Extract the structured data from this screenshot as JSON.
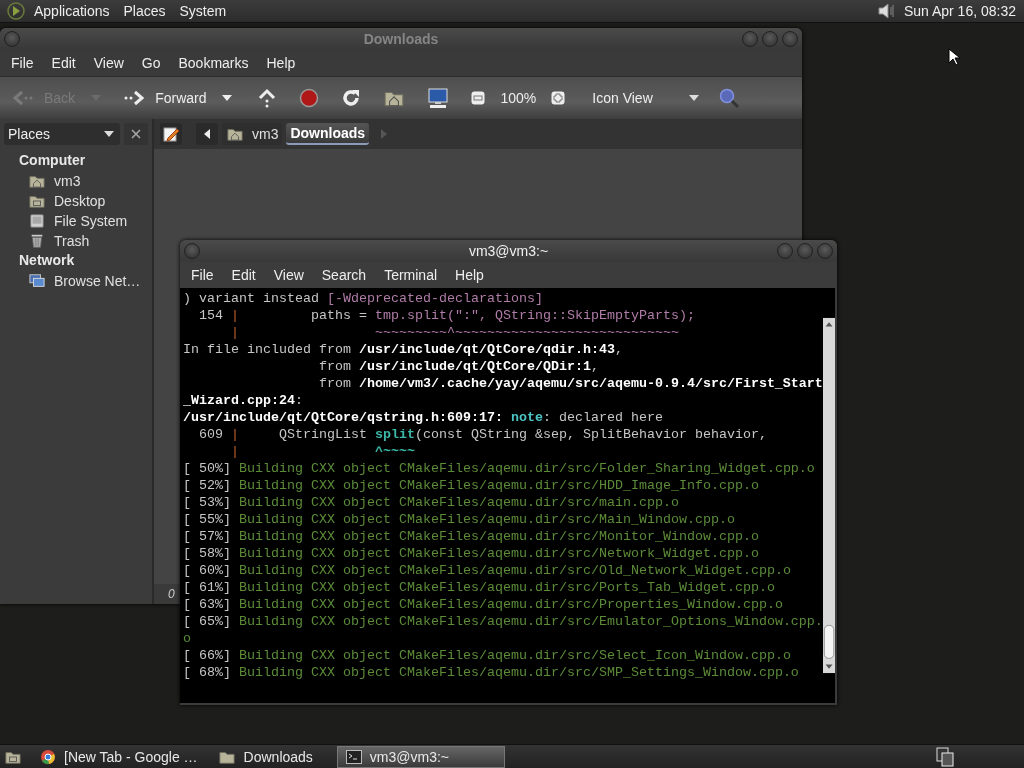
{
  "top_panel": {
    "menus": [
      "Applications",
      "Places",
      "System"
    ],
    "clock": "Sun Apr 16, 08:32"
  },
  "file_manager": {
    "title": "Downloads",
    "active": false,
    "menu": [
      "File",
      "Edit",
      "View",
      "Go",
      "Bookmarks",
      "Help"
    ],
    "toolbar": {
      "back": {
        "label": "Back",
        "disabled": true
      },
      "forward": {
        "label": "Forward",
        "disabled": false
      },
      "zoom": "100%",
      "view": "Icon View"
    },
    "sidebar": {
      "title": "Places",
      "sections": [
        {
          "heading": "Computer",
          "items": [
            {
              "label": "vm3",
              "kind": "home"
            },
            {
              "label": "Desktop",
              "kind": "desktop"
            },
            {
              "label": "File System",
              "kind": "drive"
            },
            {
              "label": "Trash",
              "kind": "trash"
            }
          ]
        },
        {
          "heading": "Network",
          "items": [
            {
              "label": "Browse Net…",
              "kind": "network"
            }
          ]
        }
      ]
    },
    "path": [
      {
        "label": "vm3",
        "kind": "home",
        "selected": false
      },
      {
        "label": "Downloads",
        "kind": "plain",
        "selected": true
      }
    ],
    "status": "0"
  },
  "terminal": {
    "title": "vm3@vm3:~",
    "active": true,
    "menu": [
      "File",
      "Edit",
      "View",
      "Search",
      "Terminal",
      "Help"
    ],
    "lines": [
      [
        {
          "kind": "text",
          "text": ") variant instead "
        },
        {
          "kind": "warn",
          "text": "[-Wdeprecated-declarations]"
        }
      ],
      [
        {
          "kind": "text",
          "text": "  154 "
        },
        {
          "kind": "gutter",
          "text": "|"
        },
        {
          "kind": "text",
          "text": "         paths = "
        },
        {
          "kind": "warn",
          "text": "tmp.split(\":\", QString::SkipEmptyParts);"
        }
      ],
      [
        {
          "kind": "gutter",
          "text": "      |"
        },
        {
          "kind": "warn",
          "text": "                 ~~~~~~~~~^~~~~~~~~~~~~~~~~~~~~~~~~~~~~"
        }
      ],
      [
        {
          "kind": "text",
          "text": "In file included from "
        },
        {
          "kind": "bold",
          "text": "/usr/include/qt/QtCore/qdir.h:43"
        },
        {
          "kind": "text",
          "text": ","
        }
      ],
      [
        {
          "kind": "text",
          "text": "                 from "
        },
        {
          "kind": "bold",
          "text": "/usr/include/qt/QtCore/QDir:1"
        },
        {
          "kind": "text",
          "text": ","
        }
      ],
      [
        {
          "kind": "text",
          "text": "                 from "
        },
        {
          "kind": "bold",
          "text": "/home/vm3/.cache/yay/aqemu/src/aqemu-0.9.4/src/First_Start"
        }
      ],
      [
        {
          "kind": "bold",
          "text": "_Wizard.cpp:24"
        },
        {
          "kind": "text",
          "text": ":"
        }
      ],
      [
        {
          "kind": "bold",
          "text": "/usr/include/qt/QtCore/qstring.h:609:17: "
        },
        {
          "kind": "note",
          "text": "note"
        },
        {
          "kind": "text",
          "text": ": declared here"
        }
      ],
      [
        {
          "kind": "text",
          "text": "  609 "
        },
        {
          "kind": "gutter",
          "text": "|"
        },
        {
          "kind": "text",
          "text": "     QStringList "
        },
        {
          "kind": "fix",
          "text": "split"
        },
        {
          "kind": "text",
          "text": "(const QString &sep, SplitBehavior behavior,"
        }
      ],
      [
        {
          "kind": "gutter",
          "text": "      |"
        },
        {
          "kind": "fix",
          "text": "                 ^~~~~"
        }
      ],
      [
        {
          "kind": "text",
          "text": "[ 50%] "
        },
        {
          "kind": "build",
          "text": "Building CXX object CMakeFiles/aqemu.dir/src/Folder_Sharing_Widget.cpp.o"
        }
      ],
      [
        {
          "kind": "text",
          "text": "[ 52%] "
        },
        {
          "kind": "build",
          "text": "Building CXX object CMakeFiles/aqemu.dir/src/HDD_Image_Info.cpp.o"
        }
      ],
      [
        {
          "kind": "text",
          "text": "[ 53%] "
        },
        {
          "kind": "build",
          "text": "Building CXX object CMakeFiles/aqemu.dir/src/main.cpp.o"
        }
      ],
      [
        {
          "kind": "text",
          "text": "[ 55%] "
        },
        {
          "kind": "build",
          "text": "Building CXX object CMakeFiles/aqemu.dir/src/Main_Window.cpp.o"
        }
      ],
      [
        {
          "kind": "text",
          "text": "[ 57%] "
        },
        {
          "kind": "build",
          "text": "Building CXX object CMakeFiles/aqemu.dir/src/Monitor_Window.cpp.o"
        }
      ],
      [
        {
          "kind": "text",
          "text": "[ 58%] "
        },
        {
          "kind": "build",
          "text": "Building CXX object CMakeFiles/aqemu.dir/src/Network_Widget.cpp.o"
        }
      ],
      [
        {
          "kind": "text",
          "text": "[ 60%] "
        },
        {
          "kind": "build",
          "text": "Building CXX object CMakeFiles/aqemu.dir/src/Old_Network_Widget.cpp.o"
        }
      ],
      [
        {
          "kind": "text",
          "text": "[ 61%] "
        },
        {
          "kind": "build",
          "text": "Building CXX object CMakeFiles/aqemu.dir/src/Ports_Tab_Widget.cpp.o"
        }
      ],
      [
        {
          "kind": "text",
          "text": "[ 63%] "
        },
        {
          "kind": "build",
          "text": "Building CXX object CMakeFiles/aqemu.dir/src/Properties_Window.cpp.o"
        }
      ],
      [
        {
          "kind": "text",
          "text": "[ 65%] "
        },
        {
          "kind": "build",
          "text": "Building CXX object CMakeFiles/aqemu.dir/src/Emulator_Options_Window.cpp."
        }
      ],
      [
        {
          "kind": "build",
          "text": "o"
        }
      ],
      [
        {
          "kind": "text",
          "text": "[ 66%] "
        },
        {
          "kind": "build",
          "text": "Building CXX object CMakeFiles/aqemu.dir/src/Select_Icon_Window.cpp.o"
        }
      ],
      [
        {
          "kind": "text",
          "text": "[ 68%] "
        },
        {
          "kind": "build",
          "text": "Building CXX object CMakeFiles/aqemu.dir/src/SMP_Settings_Window.cpp.o"
        }
      ]
    ]
  },
  "taskbar": {
    "items": [
      {
        "label": "[New Tab - Google …",
        "kind": "browser",
        "selected": false
      },
      {
        "label": "Downloads",
        "kind": "folder",
        "selected": false
      },
      {
        "label": "vm3@vm3:~",
        "kind": "terminal",
        "selected": true
      }
    ]
  }
}
